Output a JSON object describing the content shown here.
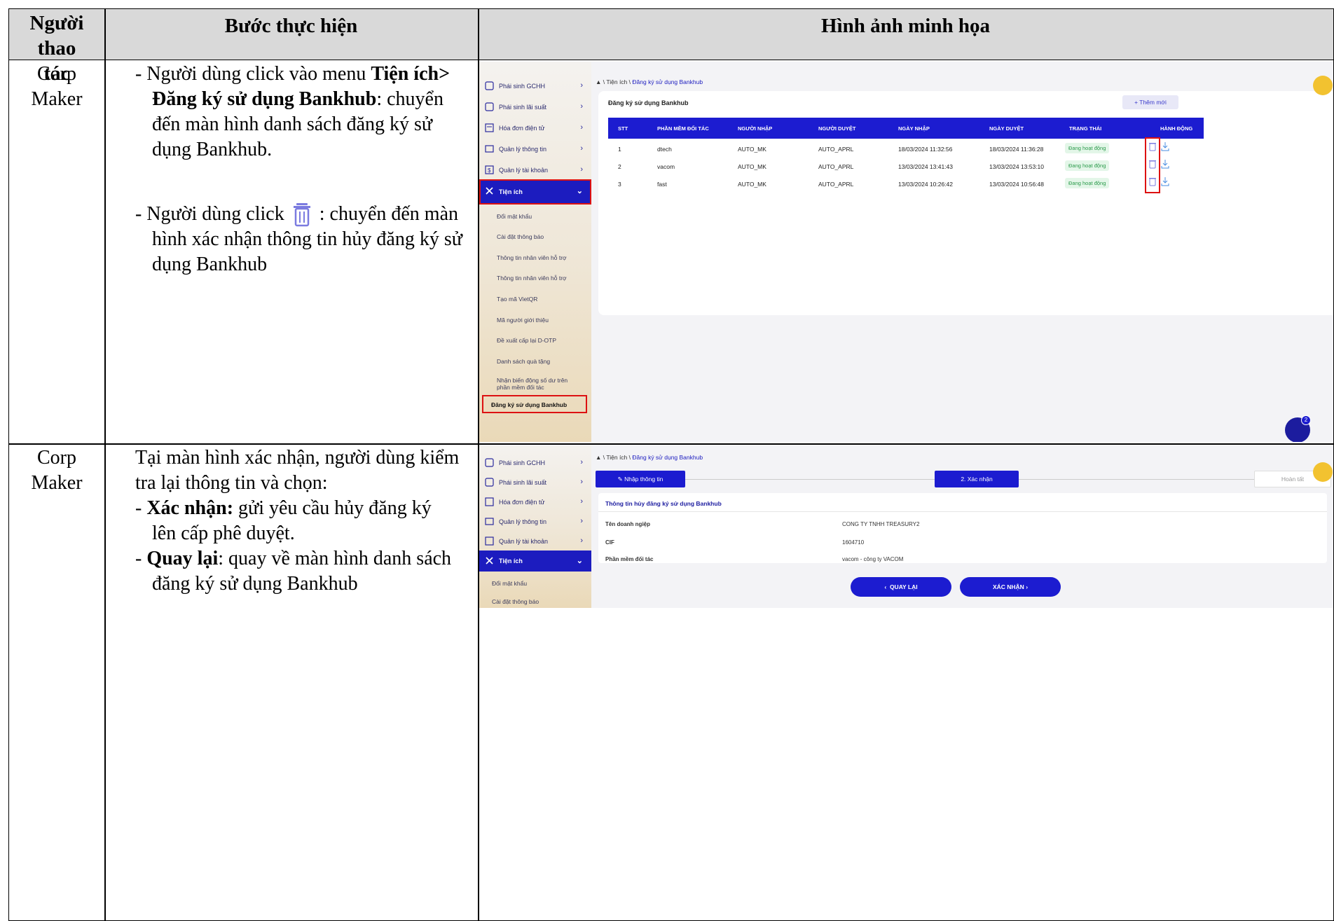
{
  "header": {
    "col1": "Người thao tác",
    "col2": "Bước thực hiện",
    "col3": "Hình ảnh minh họa"
  },
  "rows": [
    {
      "actor_line1": "Corp",
      "actor_line2": "Maker",
      "step_p1_a": "- Người dùng click vào menu ",
      "step_p1_bold": "Tiện ích> Đăng ký sử dụng Bankhub",
      "step_p1_b": ": chuyển đến màn hình danh sách đăng ký sử dụng Bankhub.",
      "step_p2_a": "- Người dùng click",
      "step_p2_b": ": chuyển đến màn hình xác nhận thông tin hủy đăng ký sử dụng Bankhub"
    },
    {
      "actor_line1": "Corp",
      "actor_line2": "Maker",
      "intro": "Tại màn hình xác nhận, người dùng kiểm tra lại thông tin và chọn:",
      "b1_bold": "Xác nhận:",
      "b1_text": " gửi yêu cầu hủy đăng ký lên cấp phê duyệt.",
      "b2_bold": "Quay lại",
      "b2_text": ": quay về màn hình danh sách đăng ký sử dụng Bankhub"
    }
  ],
  "shot1": {
    "sidebar": [
      "Phái sinh GCHH",
      "Phái sinh lãi suất",
      "Hóa đơn điện tử",
      "Quản lý thông tin",
      "Quản lý tài khoản"
    ],
    "active": "Tiện ích",
    "submenu": [
      "Đổi mật khẩu",
      "Cài đặt thông báo",
      "Thông tin nhân viên hỗ trợ",
      "Thông tin nhân viên hỗ trợ",
      "Tạo mã VietQR",
      "Mã người giới thiệu",
      "Đề xuất cấp lại D-OTP",
      "Danh sách quà tặng",
      "Nhận biến động số dư trên phần mềm đối tác",
      "Đăng ký sử dụng Bankhub"
    ],
    "crumb_prefix": "\\ Tiện ích \\",
    "crumb_link": "Đăng ký sử dụng Bankhub",
    "card_title": "Đăng ký sử dụng Bankhub",
    "add_button": "+ Thêm mới",
    "columns": [
      "STT",
      "PHẦN MỀM ĐỐI TÁC",
      "NGƯỜI NHẬP",
      "NGƯỜI DUYỆT",
      "NGÀY NHẬP",
      "NGÀY DUYỆT",
      "TRẠNG THÁI",
      "HÀNH ĐỘNG"
    ],
    "table_rows": [
      [
        "1",
        "dtech",
        "AUTO_MK",
        "AUTO_APRL",
        "18/03/2024 11:32:56",
        "18/03/2024 11:36:28",
        "Đang hoạt động"
      ],
      [
        "2",
        "vacom",
        "AUTO_MK",
        "AUTO_APRL",
        "13/03/2024 13:41:43",
        "13/03/2024 13:53:10",
        "Đang hoạt động"
      ],
      [
        "3",
        "fast",
        "AUTO_MK",
        "AUTO_APRL",
        "13/03/2024 10:26:42",
        "13/03/2024 10:56:48",
        "Đang hoạt động"
      ]
    ],
    "notif_count": "2"
  },
  "shot2": {
    "sidebar": [
      "Phái sinh GCHH",
      "Phái sinh lãi suất",
      "Hóa đơn điện tử",
      "Quản lý thông tin",
      "Quản lý tài khoản"
    ],
    "active": "Tiện ích",
    "submenu": [
      "Đổi mật khẩu",
      "Cài đặt thông báo"
    ],
    "crumb_prefix": "\\ Tiện ích \\",
    "crumb_link": "Đăng ký sử dụng Bankhub",
    "step1": "Nhập thông tin",
    "step2": "2. Xác nhận",
    "step3": "Hoàn tất",
    "card_title": "Thông tin hủy đăng ký sử dụng Bankhub",
    "fields": [
      {
        "label": "Tên doanh ngiệp",
        "value": "CONG TY TNHH TREASURY2"
      },
      {
        "label": "CIF",
        "value": "1604710"
      },
      {
        "label": "Phần mềm đối tác",
        "value": "vacom - công ty VACOM"
      }
    ],
    "back_button": "QUAY LẠI",
    "confirm_button": "XÁC NHẬN"
  }
}
